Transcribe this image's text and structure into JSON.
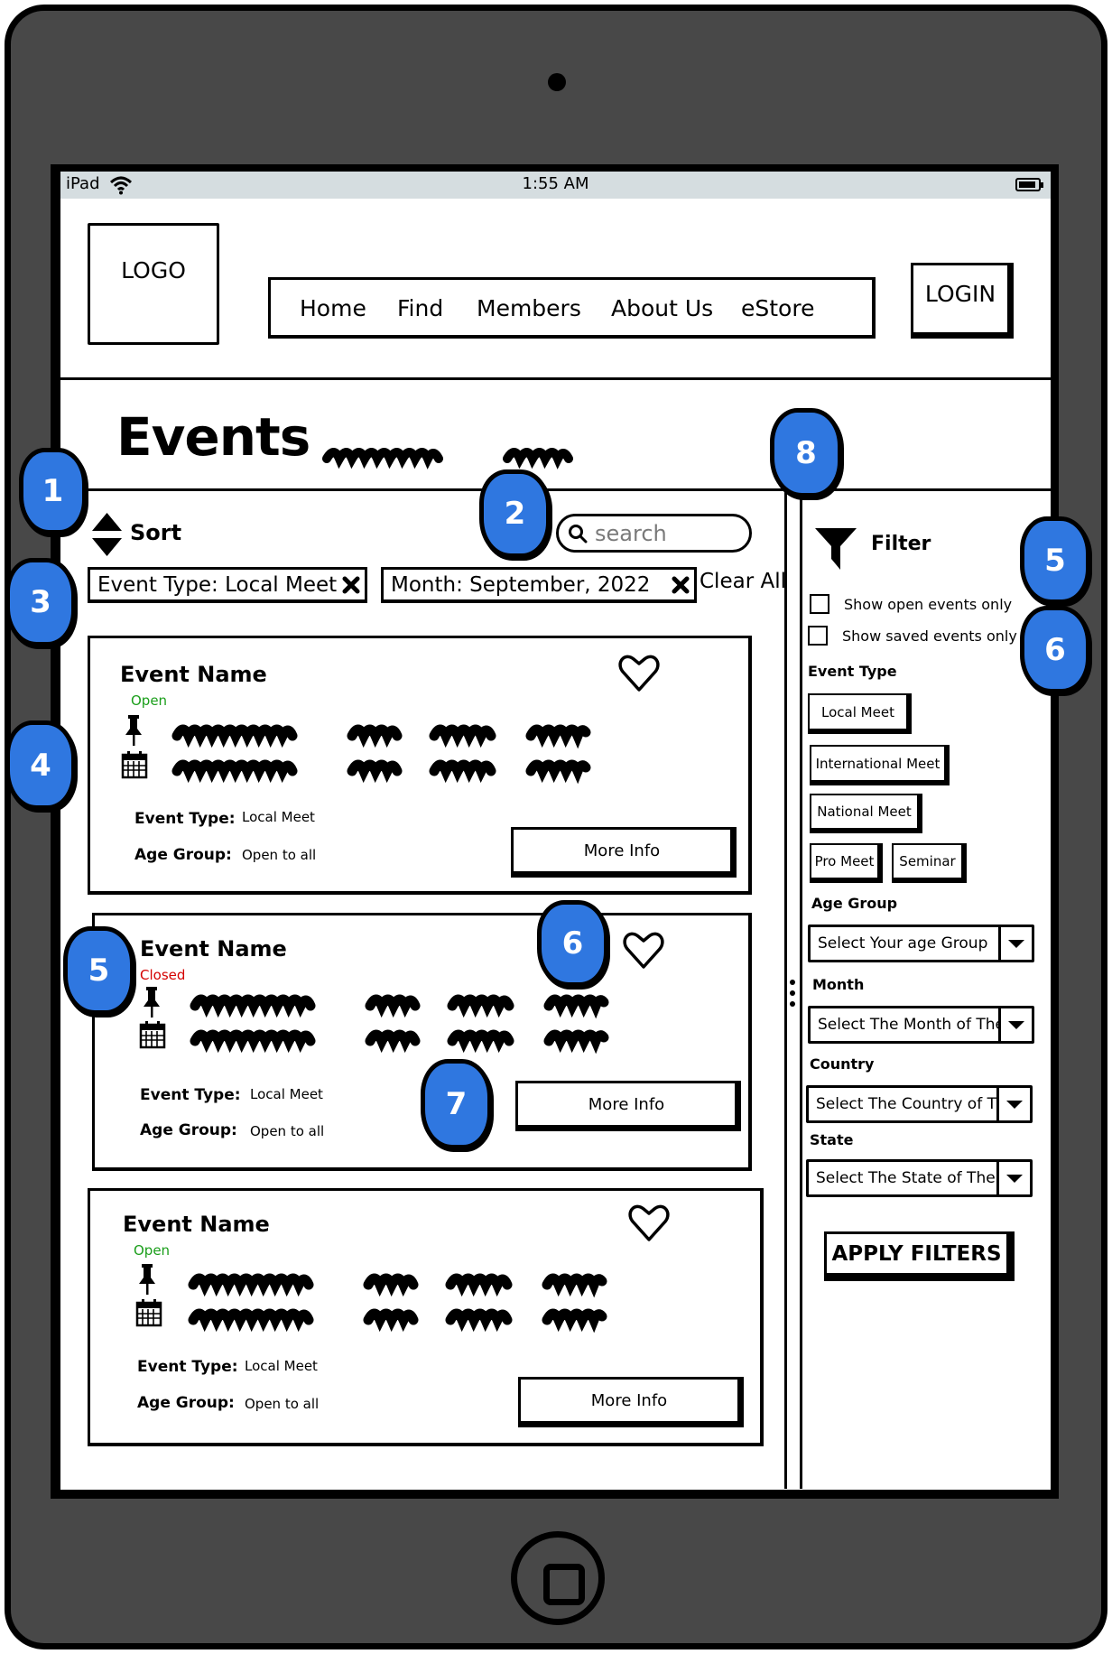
{
  "status_bar": {
    "device": "iPad",
    "time": "1:55 AM"
  },
  "header": {
    "logo": "LOGO",
    "nav": [
      "Home",
      "Find",
      "Members",
      "About Us",
      "eStore"
    ],
    "login": "LOGIN"
  },
  "page": {
    "title": "Events"
  },
  "toolbar": {
    "sort_label": "Sort",
    "search_placeholder": "search",
    "chips": [
      "Event Type: Local Meet",
      "Month: September, 2022"
    ],
    "clear_all": "Clear All"
  },
  "events": [
    {
      "name": "Event Name",
      "status": "Open",
      "status_color": "#1a9e1a",
      "event_type_label": "Event Type:",
      "event_type": "Local Meet",
      "age_group_label": "Age Group:",
      "age_group": "Open to all",
      "button": "More Info"
    },
    {
      "name": "Event Name",
      "status": "Closed",
      "status_color": "#d40000",
      "event_type_label": "Event Type:",
      "event_type": "Local Meet",
      "age_group_label": "Age Group:",
      "age_group": "Open to all",
      "button": "More Info"
    },
    {
      "name": "Event Name",
      "status": "Open",
      "status_color": "#1a9e1a",
      "event_type_label": "Event Type:",
      "event_type": "Local Meet",
      "age_group_label": "Age Group:",
      "age_group": "Open to all",
      "button": "More Info"
    }
  ],
  "filter": {
    "title": "Filter",
    "checkboxes": [
      {
        "label": "Show open events only",
        "checked": false
      },
      {
        "label": "Show saved events only",
        "checked": false
      }
    ],
    "event_type_label": "Event Type",
    "event_types": [
      "Local Meet",
      "International Meet",
      "National Meet",
      "Pro Meet",
      "Seminar"
    ],
    "age_group_label": "Age Group",
    "age_group_select": "Select Your age Group",
    "month_label": "Month",
    "month_select": "Select The Month of The Event",
    "country_label": "Country",
    "country_select": "Select The Country of The Event",
    "state_label": "State",
    "state_select": "Select The State of The Event",
    "apply": "APPLY FILTERS"
  },
  "annotations": {
    "color": "#2f77e0",
    "labels": [
      "1",
      "2",
      "3",
      "4",
      "5",
      "6",
      "7",
      "8",
      "5",
      "6"
    ]
  }
}
